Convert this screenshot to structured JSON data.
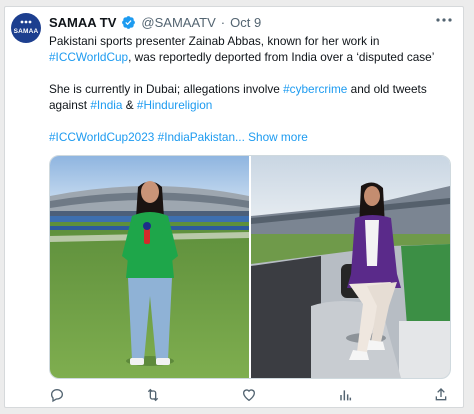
{
  "tweet": {
    "avatar_text": "SAMAA",
    "display_name": "SAMAA TV",
    "handle": "@SAMAATV",
    "separator": "·",
    "date": "Oct 9",
    "more_icon": "more-icon",
    "paragraph1": {
      "text_before": "Pakistani sports presenter Zainab Abbas, known for her work in ",
      "hashtag": "#ICCWorldCup",
      "text_after": ", was reportedly deported from India over a ‘disputed case’"
    },
    "paragraph2": {
      "text1": "She is currently in Dubai; allegations involve ",
      "hashtag1": "#cybercrime",
      "text2": " and old tweets against ",
      "hashtag2": "#India",
      "text3": " & ",
      "hashtag3": "#Hindureligion"
    },
    "paragraph3": {
      "hashtags": "#ICCWorldCup2023 #IndiaPakistan...",
      "show_more": "Show more"
    },
    "media": [
      {
        "name": "photo-stadium-green-outfit"
      },
      {
        "name": "photo-studio-purple-blazer"
      }
    ],
    "actions": [
      "reply-icon",
      "retweet-icon",
      "like-icon",
      "views-icon",
      "share-icon"
    ],
    "colors": {
      "link": "#1d9bf0",
      "verified": "#1d9bf0",
      "muted": "#536471"
    }
  }
}
